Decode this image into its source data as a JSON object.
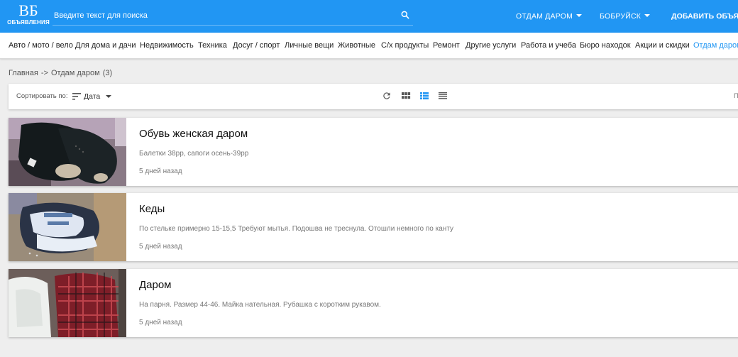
{
  "header": {
    "logo_mark": "ВБ",
    "logo_sub": "ОБЪЯВЛЕНИЯ",
    "search_placeholder": "Введите текст для поиска",
    "category_dropdown": "ОТДАМ ДАРОМ",
    "city_dropdown": "БОБРУЙСК",
    "add_button": "ДОБАВИТЬ ОБЪЯВЛ",
    "accent_color": "#2196f3"
  },
  "nav": {
    "categories": [
      "Авто / мото / вело",
      "Для дома и дачи",
      "Недвижимость",
      "Техника",
      "Досуг / спорт",
      "Личные вещи",
      "Животные",
      "С/х продукты",
      "Ремонт",
      "Другие услуги",
      "Работа и учеба",
      "Бюро находок",
      "Акции и скидки",
      "Отдам даром"
    ],
    "active_index": 13
  },
  "breadcrumb": {
    "home": "Главная",
    "separator": "->",
    "current": "Отдам даром",
    "count": "(3)"
  },
  "toolbar": {
    "sort_label": "Сортировать по:",
    "sort_value": "Дата",
    "view_icons": [
      "refresh-icon",
      "grid-view-icon",
      "list-view-icon",
      "compact-list-icon"
    ],
    "active_view": "list-view-icon",
    "right_text": "П"
  },
  "listings": [
    {
      "title": "Обувь женская даром",
      "description": "Балетки 38рр, сапоги осень-39рр",
      "time": "5 дней назад"
    },
    {
      "title": "Кеды",
      "description": "По стельке примерно 15-15,5 Требуют мытья. Подошва не треснула. Отошли немного по канту",
      "time": "5 дней назад"
    },
    {
      "title": "Даром",
      "description": "На парня. Размер 44-46. Майка нательная. Рубашка с коротким рукавом.",
      "time": "5 дней назад"
    }
  ]
}
